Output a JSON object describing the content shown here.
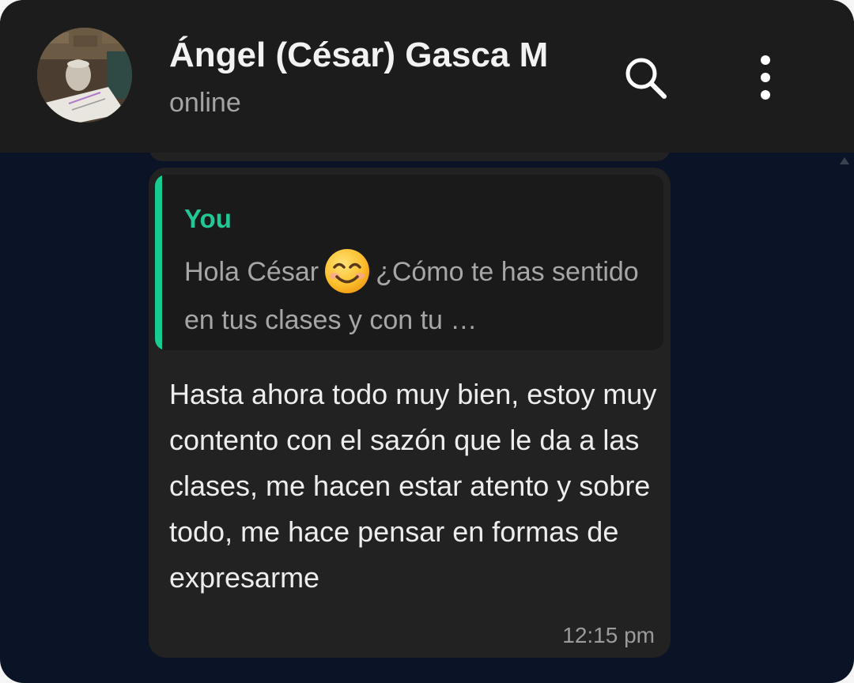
{
  "header": {
    "contact_name": "Ángel (César) Gasca M",
    "status": "online",
    "search_icon": "search-icon",
    "menu_icon": "more-vertical-icon"
  },
  "message": {
    "quote": {
      "author": "You",
      "text_before_emoji": "Hola César",
      "emoji": "smiling-face-emoji",
      "text_after_emoji": "¿Cómo te has sentido en tus clases y con tu …"
    },
    "body": "Hasta ahora todo muy bien, estoy muy contento con el sazón que le da a las clases, me hacen estar atento y sobre todo, me hace pensar en formas de expresarme",
    "time": "12:15 pm"
  },
  "colors": {
    "header_bg": "#1c1c1c",
    "chat_bg": "#0b1326",
    "bubble_bg": "#222222",
    "quote_bg": "#1a1a1a",
    "accent": "#21c795"
  }
}
